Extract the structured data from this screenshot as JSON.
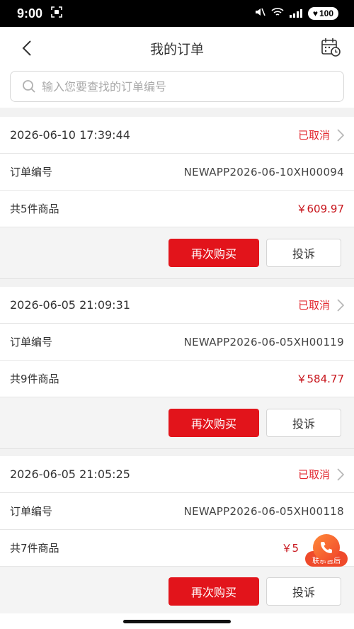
{
  "status_bar": {
    "time": "9:00",
    "battery": "100"
  },
  "nav": {
    "title": "我的订单"
  },
  "search": {
    "placeholder": "输入您要查找的订单编号"
  },
  "orders": [
    {
      "date": "2026-06-10 17:39:44",
      "status": "已取消",
      "order_no_label": "订单编号",
      "order_no": "NEWAPP2026-06-10XH00094",
      "count_text": "共5件商品",
      "price": "￥609.97",
      "rebuy_label": "再次购买",
      "complain_label": "投诉"
    },
    {
      "date": "2026-06-05 21:09:31",
      "status": "已取消",
      "order_no_label": "订单编号",
      "order_no": "NEWAPP2026-06-05XH00119",
      "count_text": "共9件商品",
      "price": "￥584.77",
      "rebuy_label": "再次购买",
      "complain_label": "投诉"
    },
    {
      "date": "2026-06-05 21:05:25",
      "status": "已取消",
      "order_no_label": "订单编号",
      "order_no": "NEWAPP2026-06-05XH00118",
      "count_text": "共7件商品",
      "price": "￥5",
      "rebuy_label": "再次购买",
      "complain_label": "投诉"
    }
  ],
  "float_service": {
    "label": "联系售后",
    "icon": "phone-icon"
  },
  "colors": {
    "accent_red": "#e2141b",
    "price_red": "#c8161d",
    "service_orange": "#ef4a2b"
  }
}
